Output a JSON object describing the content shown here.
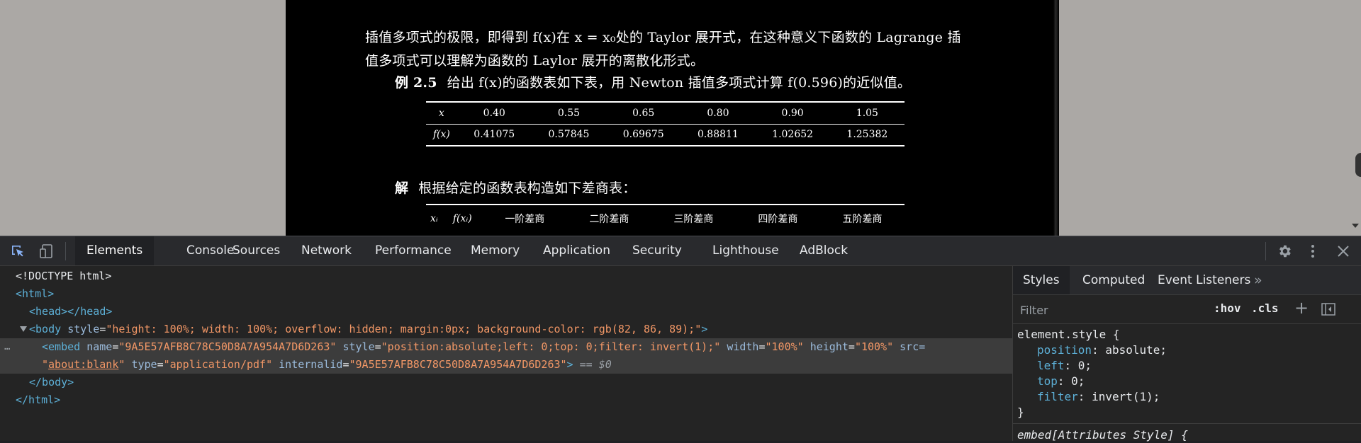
{
  "pdf": {
    "para1": "插值多项式的极限，即得到 f(x)在 x = x₀处的 Taylor 展开式，在这种意义下函数的 Lagrange 插",
    "para2": "值多项式可以理解为函数的 Laylor 展开的离散化形式。",
    "example_label": "例 2.5",
    "example_text": "给出 f(x)的函数表如下表，用 Newton 插值多项式计算 f(0.596)的近似值。",
    "table1": {
      "row_x_header": "x",
      "row_x": [
        "0.40",
        "0.55",
        "0.65",
        "0.80",
        "0.90",
        "1.05"
      ],
      "row_f_header": "f(x)",
      "row_f": [
        "0.41075",
        "0.57845",
        "0.69675",
        "0.88811",
        "1.02652",
        "1.25382"
      ]
    },
    "solution_label": "解",
    "solution_text": "根据给定的函数表构造如下差商表：",
    "table2_headers": [
      "xᵢ",
      "f(xᵢ)",
      "一阶差商",
      "二阶差商",
      "三阶差商",
      "四阶差商",
      "五阶差商"
    ]
  },
  "devtools": {
    "tabs": [
      "Elements",
      "Console",
      "Sources",
      "Network",
      "Performance",
      "Memory",
      "Application",
      "Security",
      "Lighthouse",
      "AdBlock"
    ],
    "dom": {
      "doctype": "<!DOCTYPE html>",
      "html_open": "<html>",
      "head": "<head></head>",
      "body_open_tag": "<body",
      "body_style_attr": "style",
      "body_style_val": "\"height: 100%; width: 100%; overflow: hidden; margin:0px; background-color: rgb(82, 86, 89);\"",
      "body_close_bracket": ">",
      "embed_open": "<embed",
      "embed_name_attr": "name",
      "embed_name_val": "\"9A5E57AFB8C78C50D8A7A954A7D6D263\"",
      "embed_style_attr": "style",
      "embed_style_val": "\"position:absolute;left: 0;top: 0;filter: invert(1);\"",
      "embed_width_attr": "width",
      "embed_width_val": "\"100%\"",
      "embed_height_attr": "height",
      "embed_height_val": "\"100%\"",
      "embed_src_attr": "src=",
      "embed_src_val_q1": "\"",
      "embed_src_val": "about:blank",
      "embed_src_val_q2": "\"",
      "embed_type_attr": "type",
      "embed_type_val": "\"application/pdf\"",
      "embed_internalid_attr": "internalid",
      "embed_internalid_val": "\"9A5E57AFB8C78C50D8A7A954A7D6D263\"",
      "embed_close": ">",
      "selected_marker": "== $0",
      "body_close": "</body>",
      "html_close": "</html>",
      "dots": "…"
    },
    "sidebar": {
      "tabs": [
        "Styles",
        "Computed",
        "Event Listeners"
      ],
      "more": "»",
      "filter_placeholder": "Filter",
      "hov": ":hov",
      "cls": ".cls",
      "plus": "+",
      "rule1_selector": "element.style {",
      "rule1_props": [
        {
          "name": "position",
          "value": "absolute;"
        },
        {
          "name": "left",
          "value": "0;"
        },
        {
          "name": "top",
          "value": "0;"
        },
        {
          "name": "filter",
          "value": "invert(1);"
        }
      ],
      "rule1_close": "}",
      "rule2_selector": "embed[Attributes Style] {"
    }
  }
}
